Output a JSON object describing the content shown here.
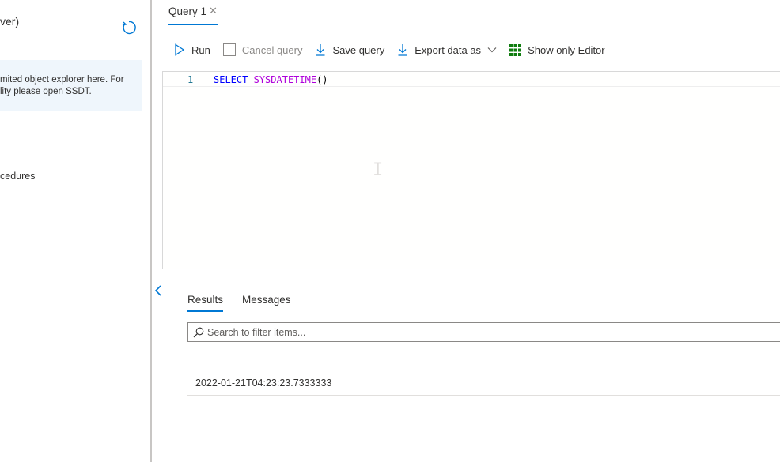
{
  "left_panel": {
    "title": "ver)",
    "info_lines": [
      "mited object explorer here. For",
      "lity please open SSDT."
    ],
    "tree_item": "cedures"
  },
  "query_tab": {
    "label": "Query 1",
    "close_symbol": "✕"
  },
  "toolbar": {
    "run_label": "Run",
    "cancel_label": "Cancel query",
    "save_label": "Save query",
    "export_label": "Export data as",
    "show_editor_label": "Show only Editor"
  },
  "editor": {
    "line_number": "1",
    "code": {
      "keyword": "SELECT",
      "function": "SYSDATETIME",
      "parens": "()"
    }
  },
  "results": {
    "tabs": [
      "Results",
      "Messages"
    ],
    "active_tab": "Results",
    "filter_placeholder": "Search to filter items...",
    "rows": [
      "2022-01-21T04:23:23.7333333"
    ]
  },
  "colors": {
    "accent": "#0078d4",
    "grid_icon": "#107c10",
    "info_bg": "#eff6fc"
  },
  "icons": [
    "refresh-icon",
    "play-icon",
    "checkbox-icon",
    "download-icon",
    "chevron-down-icon",
    "grid-icon",
    "chevron-left-icon",
    "search-icon",
    "close-icon"
  ]
}
